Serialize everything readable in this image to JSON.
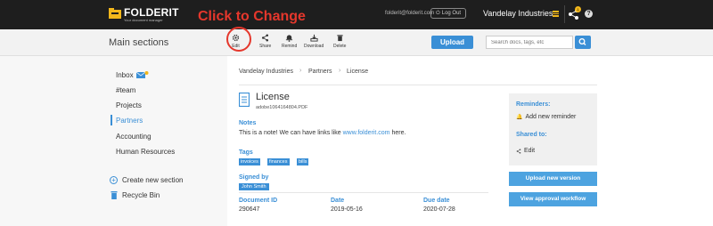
{
  "topbar": {
    "logo_text": "FOLDERIT",
    "logo_subtitle": "Your document manager",
    "callout": "Click to Change",
    "email": "folderit@folderit.com",
    "logout_label": "Log Out",
    "org_name": "Vandelay Industries",
    "share_badge": "1",
    "help_label": "?"
  },
  "toolbar": {
    "section_title": "Main sections",
    "actions": [
      {
        "label": "Edit",
        "icon": "gear-icon"
      },
      {
        "label": "Share",
        "icon": "share-icon"
      },
      {
        "label": "Remind",
        "icon": "bell-icon"
      },
      {
        "label": "Download",
        "icon": "download-icon"
      },
      {
        "label": "Delete",
        "icon": "trash-icon"
      }
    ],
    "upload_label": "Upload",
    "search_placeholder": "Search docs, tags, etc"
  },
  "sidebar": {
    "items": [
      {
        "label": "Inbox"
      },
      {
        "label": "#team"
      },
      {
        "label": "Projects"
      },
      {
        "label": "Partners",
        "active": true
      },
      {
        "label": "Accounting"
      },
      {
        "label": "Human Resources"
      }
    ],
    "create_label": "Create new section",
    "recycle_label": "Recycle Bin"
  },
  "breadcrumb": [
    "Vandelay Industries",
    "Partners",
    "License"
  ],
  "document": {
    "title": "License",
    "filename": "adobe1064164804.PDF",
    "notes_label": "Notes",
    "notes_text": "This is a note! We can have links like",
    "notes_link": "www.folderit.com",
    "notes_suffix": "here.",
    "tags_label": "Tags",
    "tags": [
      "invoices",
      "finances",
      "bills"
    ],
    "signed_label": "Signed by",
    "signer": "John Smith",
    "doc_id_label": "Document ID",
    "doc_id": "290647",
    "date_label": "Date",
    "date": "2019-05-16",
    "due_label": "Due date",
    "due_date": "2020-07-28"
  },
  "panel": {
    "reminders_label": "Reminders:",
    "add_reminder": "Add new reminder",
    "shared_label": "Shared to:",
    "shared_item": "Edit",
    "upload_version": "Upload new version",
    "approval": "View approval workflow"
  },
  "colors": {
    "accent": "#3a8fd6",
    "callout": "#e5372c",
    "topbar": "#1e1e1e",
    "logo": "#f3b71b"
  }
}
